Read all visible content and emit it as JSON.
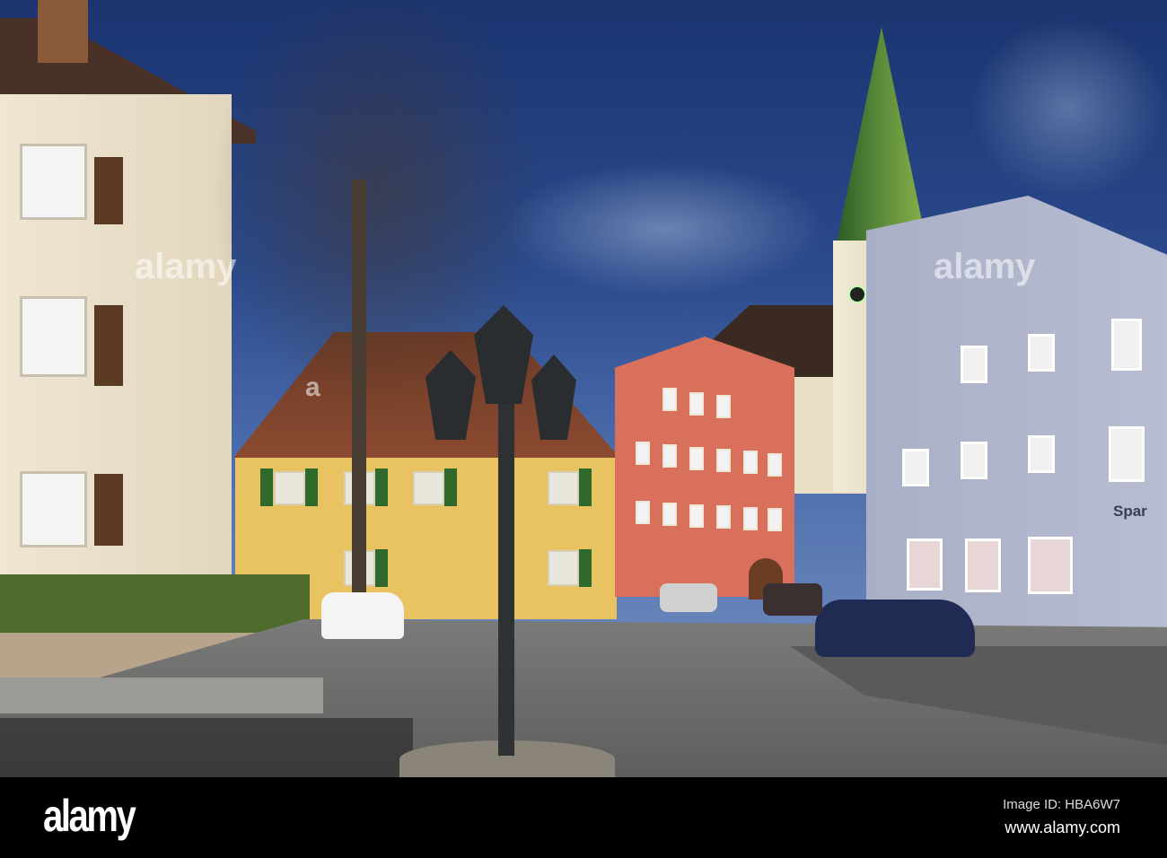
{
  "watermark": {
    "center_text": "alamy",
    "small_mark": "a"
  },
  "shop_sign": "Spar",
  "footer": {
    "logo": "alamy",
    "image_id": "Image ID: HBA6W7",
    "url": "www.alamy.com"
  },
  "colors": {
    "sky": "#2b4a8c",
    "road": "#6b6b6b",
    "footer": "#000000"
  }
}
